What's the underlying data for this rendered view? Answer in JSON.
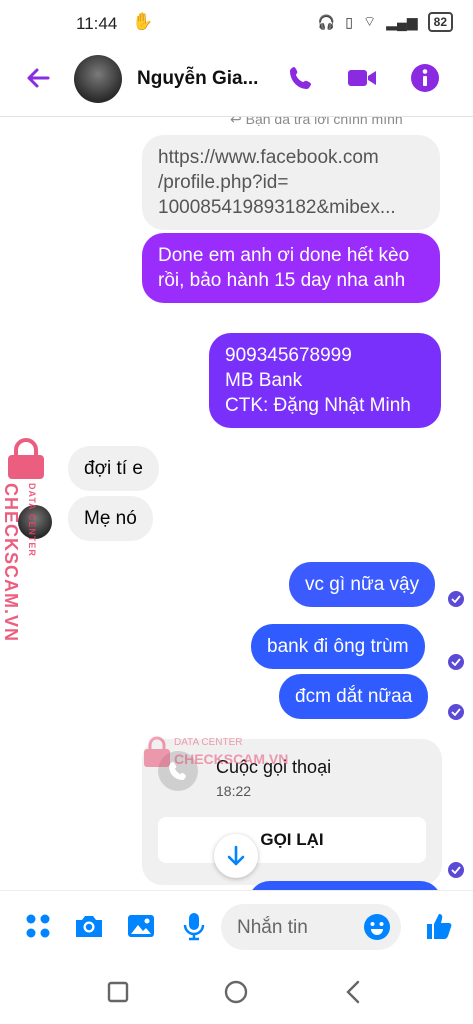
{
  "status_bar": {
    "time": "11:44",
    "battery": "82"
  },
  "header": {
    "contact_name": "Nguyễn Gia...",
    "accent_color": "#8a2be2",
    "icons": [
      "back-arrow-icon",
      "phone-icon",
      "video-camera-icon",
      "info-icon"
    ]
  },
  "chat": {
    "reply_note": "Bạn đã trả lời chính mình",
    "messages": [
      {
        "from": "me",
        "style": "gray",
        "text": "https://www.facebook.com\n/profile.php?id=\n100085419893182&mibex..."
      },
      {
        "from": "me",
        "style": "purple",
        "text": "Done em anh ơi done hết kèo rồi, bảo hành 15 day nha anh"
      },
      {
        "from": "me",
        "style": "purple",
        "text": "909345678999\nMB Bank\nCTK: Đặng Nhật Minh"
      },
      {
        "from": "them",
        "style": "gray",
        "text": "đợi tí e"
      },
      {
        "from": "them",
        "style": "gray",
        "text": "Mẹ nó"
      },
      {
        "from": "me",
        "style": "blue",
        "text": "vc gì nữa vậy"
      },
      {
        "from": "me",
        "style": "blue",
        "text": "bank đi ông trùm"
      },
      {
        "from": "me",
        "style": "blue",
        "text": "đcm dắt nữaa"
      }
    ],
    "call_card": {
      "title": "Cuộc gọi thoại",
      "time": "18:22",
      "button": "GỌI LẠI"
    },
    "watermark_text": [
      "DATA CENTER",
      "CHECKSCAM.VN"
    ]
  },
  "composer": {
    "placeholder": "Nhắn tin",
    "icons": [
      "apps-icon",
      "camera-icon",
      "image-icon",
      "microphone-icon",
      "emoji-icon",
      "like-icon"
    ]
  },
  "colors": {
    "messenger_blue": "#0084ff",
    "purple_top": "#a033ff",
    "blue_bottom": "#2f5bff",
    "watermark": "#e8436a"
  }
}
